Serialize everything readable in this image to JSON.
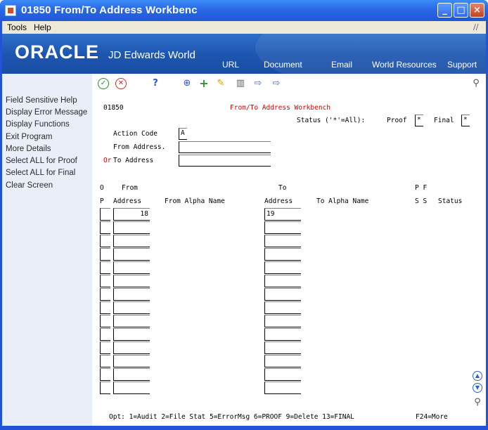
{
  "window": {
    "title": "01850     From/To Address Workbenc"
  },
  "menu": {
    "items": [
      "Tools",
      "Help"
    ]
  },
  "banner": {
    "logo_oracle": "ORACLE",
    "logo_jde": "JD Edwards World",
    "nav": [
      "URL",
      "Document",
      "Email",
      "World Resources",
      "Support"
    ]
  },
  "exits": [
    "Field Sensitive Help",
    "Display Error Message",
    "Display Functions",
    "Exit Program",
    "More Details",
    "Select ALL for Proof",
    "Select ALL for Final",
    "Clear Screen"
  ],
  "form": {
    "program_id": "01850",
    "form_title": "From/To Address Workbench",
    "status_label": "Status ('*'=All):",
    "proof_label": "Proof",
    "proof_value": "*",
    "final_label": "Final",
    "final_value": "*",
    "action_code_label": "Action Code",
    "action_code_value": "A",
    "from_address_label": "From Address.",
    "from_address_value": "",
    "or_label": "Or",
    "to_address_label": "To Address",
    "to_address_value": ""
  },
  "grid": {
    "header1": {
      "o": "O",
      "from": "From",
      "to": "To",
      "pf": "P F"
    },
    "header2": {
      "p": "P",
      "from_address": "Address",
      "from_alpha": "From Alpha Name",
      "to_address": "Address",
      "to_alpha": "To Alpha Name",
      "ss": "S S",
      "status": "Status"
    },
    "rows": [
      {
        "from": "18",
        "to": "19"
      },
      {
        "from": "",
        "to": ""
      },
      {
        "from": "",
        "to": ""
      },
      {
        "from": "",
        "to": ""
      },
      {
        "from": "",
        "to": ""
      },
      {
        "from": "",
        "to": ""
      },
      {
        "from": "",
        "to": ""
      },
      {
        "from": "",
        "to": ""
      },
      {
        "from": "",
        "to": ""
      },
      {
        "from": "",
        "to": ""
      },
      {
        "from": "",
        "to": ""
      },
      {
        "from": "",
        "to": ""
      },
      {
        "from": "",
        "to": ""
      },
      {
        "from": "",
        "to": ""
      }
    ]
  },
  "footer": {
    "options": "Opt: 1=Audit 2=File Stat 5=ErrorMsg 6=PROOF 9=Delete 13=FINAL",
    "more": "F24=More"
  },
  "colors": {
    "title_bar": "#2b6ae8",
    "banner": "#1c55b0",
    "left_pane": "#e9eef8",
    "form_title": "#d80000"
  },
  "icons": {
    "toolbar": [
      "check-icon",
      "cancel-icon",
      "help-icon",
      "inquire-icon",
      "add-icon",
      "edit-icon",
      "delete-icon",
      "copy-icon",
      "paste-icon",
      "search-icon"
    ],
    "scroll": [
      "scroll-up-icon",
      "scroll-down-icon",
      "zoom-icon"
    ]
  }
}
